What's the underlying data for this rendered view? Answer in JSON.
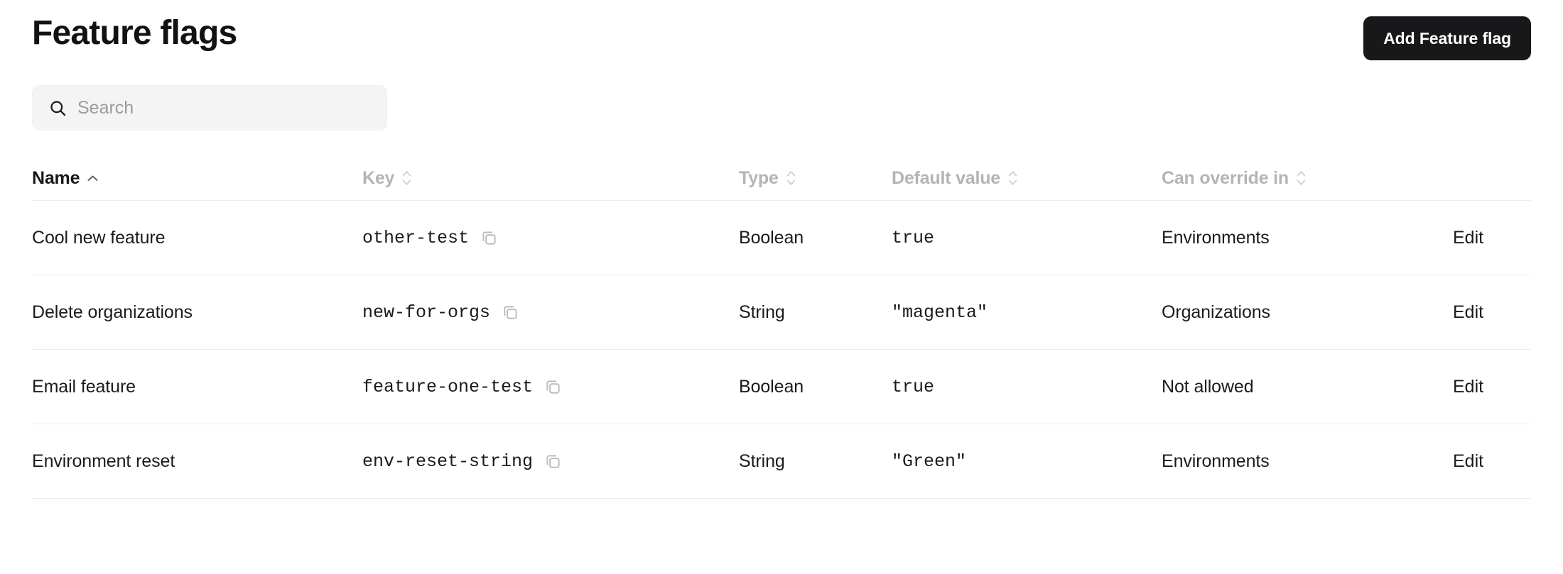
{
  "header": {
    "title": "Feature flags",
    "add_button_label": "Add Feature flag"
  },
  "search": {
    "placeholder": "Search",
    "value": "",
    "icon": "search-icon"
  },
  "table": {
    "columns": [
      {
        "label": "Name",
        "sort": "asc",
        "active": true
      },
      {
        "label": "Key",
        "sort": "none",
        "active": false
      },
      {
        "label": "Type",
        "sort": "none",
        "active": false
      },
      {
        "label": "Default value",
        "sort": "none",
        "active": false
      },
      {
        "label": "Can override in",
        "sort": "none",
        "active": false
      },
      {
        "label": "",
        "sort": "none",
        "active": false
      }
    ],
    "rows": [
      {
        "name": "Cool new feature",
        "key": "other-test",
        "copy_icon": "copy-icon",
        "type": "Boolean",
        "default_value": "true",
        "can_override_in": "Environments",
        "edit_label": "Edit"
      },
      {
        "name": "Delete organizations",
        "key": "new-for-orgs",
        "copy_icon": "copy-icon",
        "type": "String",
        "default_value": "\"magenta\"",
        "can_override_in": "Organizations",
        "edit_label": "Edit"
      },
      {
        "name": "Email feature",
        "key": "feature-one-test",
        "copy_icon": "copy-icon",
        "type": "Boolean",
        "default_value": "true",
        "can_override_in": "Not allowed",
        "edit_label": "Edit"
      },
      {
        "name": "Environment reset",
        "key": "env-reset-string",
        "copy_icon": "copy-icon",
        "type": "String",
        "default_value": "\"Green\"",
        "can_override_in": "Environments",
        "edit_label": "Edit"
      }
    ]
  },
  "colors": {
    "button_background": "#18181b",
    "button_text": "#ffffff",
    "page_background": "#ffffff",
    "search_background": "#f4f4f5",
    "header_inactive_text": "#b4b4b8",
    "divider": "#ededed",
    "body_text": "#1b1b1f"
  }
}
